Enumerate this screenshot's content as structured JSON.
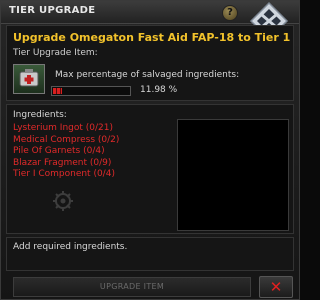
{
  "window": {
    "title": "TIER UPGRADE",
    "help_label": "?"
  },
  "upgrade": {
    "title": "Upgrade Omegaton Fast Aid FAP-18 to Tier 1",
    "item_label": "Tier Upgrade Item:",
    "salvage_label": "Max percentage of salvaged ingredients:",
    "salvage_percent_text": "11.98 %",
    "salvage_fraction": 0.1198
  },
  "ingredients": {
    "header": "Ingredients:",
    "items": [
      "Lysterium Ingot (0/21)",
      "Medical Compress (0/2)",
      "Pile Of Garnets (0/4)",
      "Blazar Fragment (0/9)",
      "Tier I Component (0/4)"
    ]
  },
  "status": {
    "message": "Add required ingredients."
  },
  "buttons": {
    "upgrade_label": "UPGRADE ITEM",
    "cancel_label": "✕"
  },
  "colors": {
    "title_accent": "#f2c22b",
    "missing_ingredient": "#e02a2a",
    "progress_fill": "#d92020"
  },
  "icons": {
    "item": "medkit-icon",
    "corner": "window-emblem-icon",
    "watermark": "gear-icon"
  }
}
